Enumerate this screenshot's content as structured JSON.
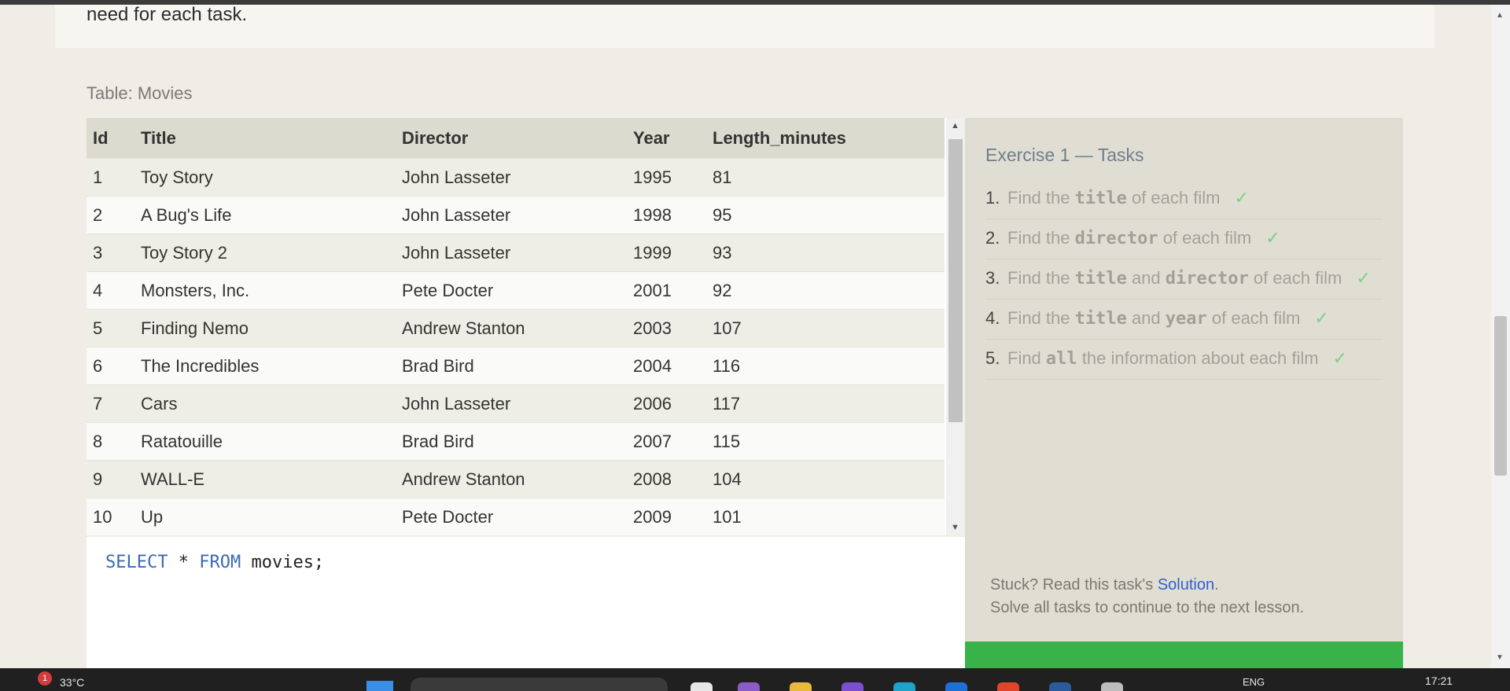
{
  "intro": {
    "text": "need for each task."
  },
  "table": {
    "caption": "Table: Movies",
    "columns": [
      "Id",
      "Title",
      "Director",
      "Year",
      "Length_minutes"
    ],
    "rows": [
      [
        "1",
        "Toy Story",
        "John Lasseter",
        "1995",
        "81"
      ],
      [
        "2",
        "A Bug's Life",
        "John Lasseter",
        "1998",
        "95"
      ],
      [
        "3",
        "Toy Story 2",
        "John Lasseter",
        "1999",
        "93"
      ],
      [
        "4",
        "Monsters, Inc.",
        "Pete Docter",
        "2001",
        "92"
      ],
      [
        "5",
        "Finding Nemo",
        "Andrew Stanton",
        "2003",
        "107"
      ],
      [
        "6",
        "The Incredibles",
        "Brad Bird",
        "2004",
        "116"
      ],
      [
        "7",
        "Cars",
        "John Lasseter",
        "2006",
        "117"
      ],
      [
        "8",
        "Ratatouille",
        "Brad Bird",
        "2007",
        "115"
      ],
      [
        "9",
        "WALL-E",
        "Andrew Stanton",
        "2008",
        "104"
      ],
      [
        "10",
        "Up",
        "Pete Docter",
        "2009",
        "101"
      ]
    ]
  },
  "editor": {
    "kw_select": "SELECT",
    "star": " * ",
    "kw_from": "FROM",
    "rest": " movies;"
  },
  "tasks": {
    "title": "Exercise 1 — Tasks",
    "items": [
      {
        "num": "1.",
        "parts": [
          "Find the ",
          "title",
          " of each film"
        ],
        "check": "✓"
      },
      {
        "num": "2.",
        "parts": [
          "Find the ",
          "director",
          " of each film"
        ],
        "check": "✓"
      },
      {
        "num": "3.",
        "parts": [
          "Find the ",
          "title",
          " and ",
          "director",
          " of each film"
        ],
        "check": "✓"
      },
      {
        "num": "4.",
        "parts": [
          "Find the ",
          "title",
          " and ",
          "year",
          " of each film"
        ],
        "check": "✓"
      },
      {
        "num": "5.",
        "parts": [
          "Find ",
          "all",
          " the information about each film"
        ],
        "check": "✓"
      }
    ],
    "stuck_prefix": "Stuck? Read this task's ",
    "solution_link": "Solution",
    "stuck_suffix": ".",
    "continue_note": "Solve all tasks to continue to the next lesson."
  },
  "taskbar": {
    "weather": "33°C",
    "weather_badge": "1",
    "lang": "ENG",
    "time": "17:21"
  },
  "colors": {
    "accent_green": "#3ab24a",
    "keyword_blue": "#3b6bb0",
    "check_green": "#7ccf8a",
    "link_blue": "#2f5fd0"
  }
}
